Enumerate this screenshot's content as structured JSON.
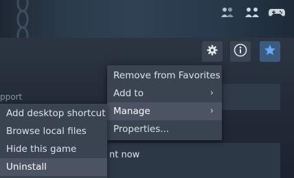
{
  "background": {
    "support_label": "pport",
    "bottom_panel_text": "nt now"
  },
  "actions": {
    "gear_icon": "gear-icon",
    "info_icon": "info-icon",
    "star_icon": "star-icon"
  },
  "context_menu": {
    "items": [
      {
        "label": "Remove from Favorites"
      },
      {
        "label": "Add to",
        "submenu": true
      },
      {
        "label": "Manage",
        "submenu": true,
        "highlighted": true
      },
      {
        "label": "Properties..."
      }
    ]
  },
  "manage_submenu": {
    "items": [
      {
        "label": "Add desktop shortcut"
      },
      {
        "label": "Browse local files"
      },
      {
        "label": "Hide this game"
      },
      {
        "label": "Uninstall",
        "highlighted": true
      }
    ]
  },
  "colors": {
    "menu_bg": "#3a4350",
    "menu_highlight": "#4c5463",
    "favorite_button": "#3d5a80"
  }
}
